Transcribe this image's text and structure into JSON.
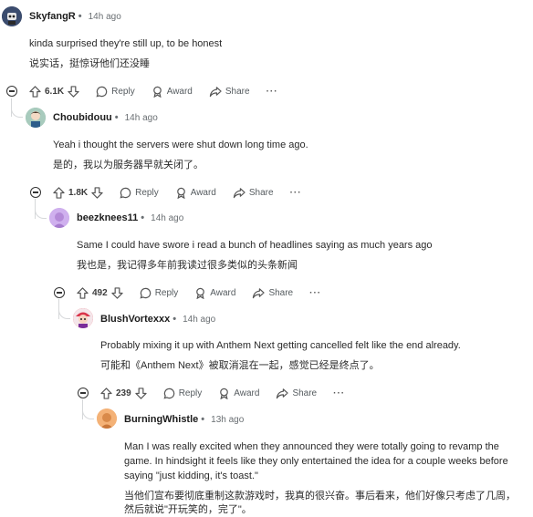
{
  "comments": [
    {
      "author": "SkyfangR",
      "time": "14h ago",
      "text_en": "kinda surprised they're still up, to be honest",
      "text_zh": "说实话，挺惊讶他们还没睡",
      "votes": "6.1K",
      "avatar_color": "#2a3a5a"
    },
    {
      "author": "Choubidouu",
      "time": "14h ago",
      "text_en": "Yeah i thought the servers were shut down long time ago.",
      "text_zh": "是的，我以为服务器早就关闭了。",
      "votes": "1.8K",
      "avatar_color": "#8fb7a8"
    },
    {
      "author": "beezknees11",
      "time": "14h ago",
      "text_en": "Same I could have swore i read a bunch of headlines saying as much years ago",
      "text_zh": "我也是，我记得多年前我读过很多类似的头条新闻",
      "votes": "492",
      "avatar_color": "#c9a6e8"
    },
    {
      "author": "BlushVortexxx",
      "time": "14h ago",
      "text_en": "Probably mixing it up with Anthem Next getting cancelled felt like the end already.",
      "text_zh": "可能和《Anthem Next》被取消混在一起，感觉已经是终点了。",
      "votes": "239",
      "avatar_color": "#e85a6a"
    },
    {
      "author": "BurningWhistle",
      "time": "13h ago",
      "text_en_1": "Man I was really excited when they announced they were totally going to revamp the",
      "text_en_2": "game. In hindsight it feels like they only entertained the idea for a couple weeks before",
      "text_en_3": "saying \"just kidding, it's toast.\"",
      "text_zh_1": "当他们宣布要彻底重制这款游戏时，我真的很兴奋。事后看来，他们好像只考虑了几周，",
      "text_zh_2": "然后就说\"开玩笑的，完了\"。",
      "avatar_color": "#f0a868"
    }
  ],
  "actions": {
    "reply": "Reply",
    "award": "Award",
    "share": "Share",
    "more": "···",
    "dot": "•"
  }
}
